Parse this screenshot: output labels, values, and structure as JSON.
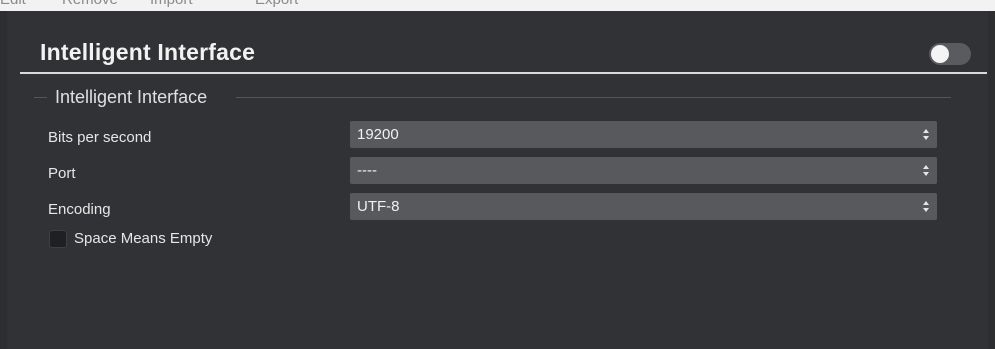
{
  "top_toolbar": {
    "items": [
      "Edit",
      "Remove",
      "Import",
      "Export"
    ]
  },
  "panel": {
    "title": "Intelligent Interface",
    "enabled": false,
    "group": {
      "legend": "Intelligent Interface",
      "fields": [
        {
          "label": "Bits per second",
          "value": "19200"
        },
        {
          "label": "Port",
          "value": "----"
        },
        {
          "label": "Encoding",
          "value": "UTF-8"
        }
      ],
      "checkbox": {
        "label": "Space Means Empty",
        "checked": false
      }
    }
  },
  "colors": {
    "background": "#2d2e30",
    "panel": "#313235",
    "select": "#57595c",
    "toggle_off": "#5a5b5e"
  }
}
